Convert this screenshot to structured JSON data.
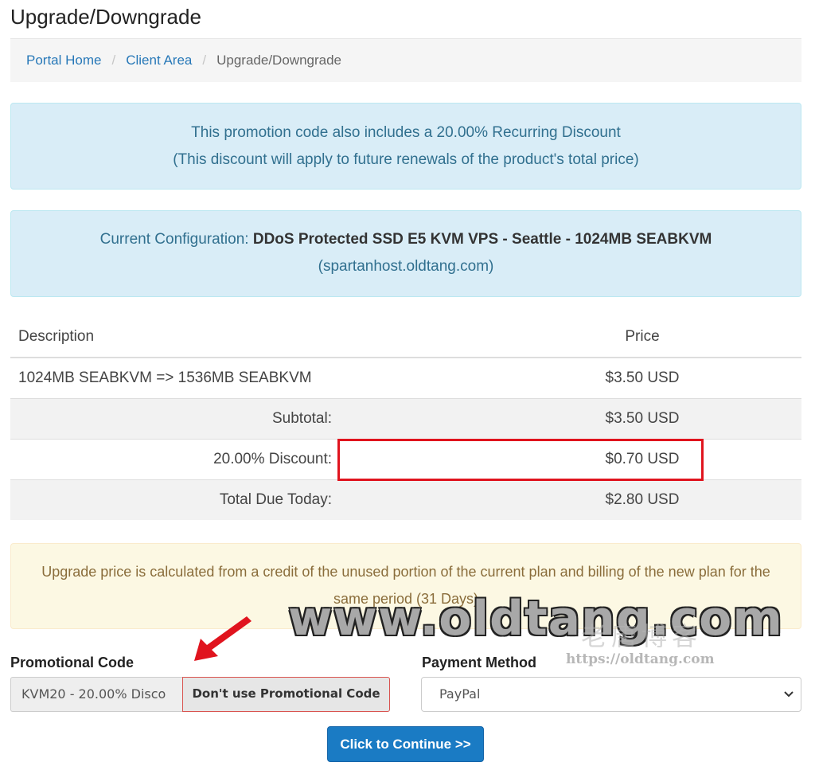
{
  "page": {
    "title": "Upgrade/Downgrade"
  },
  "breadcrumb": {
    "home": "Portal Home",
    "client_area": "Client Area",
    "current": "Upgrade/Downgrade",
    "separator": "/"
  },
  "promo_alert": {
    "line1": "This promotion code also includes a 20.00% Recurring Discount",
    "line2": "(This discount will apply to future renewals of the product's total price)"
  },
  "config_alert": {
    "label": "Current Configuration:",
    "product": "DDoS Protected SSD E5 KVM VPS - Seattle - 1024MB SEABKVM",
    "domain": "(spartanhost.oldtang.com)"
  },
  "table": {
    "headers": {
      "description": "Description",
      "price": "Price"
    },
    "item": {
      "description": "1024MB SEABKVM => 1536MB SEABKVM",
      "price": "$3.50 USD"
    },
    "subtotal": {
      "label": "Subtotal:",
      "value": "$3.50 USD"
    },
    "discount": {
      "label": "20.00% Discount:",
      "value": "$0.70 USD"
    },
    "total": {
      "label": "Total Due Today:",
      "value": "$2.80 USD"
    }
  },
  "warning": {
    "text": "Upgrade price is calculated from a credit of the unused portion of the current plan and billing of the new plan for the same period (31 Days)"
  },
  "promo": {
    "label": "Promotional Code",
    "value": "KVM20 - 20.00% Disco",
    "remove_label": "Don't use Promotional Code"
  },
  "payment": {
    "label": "Payment Method",
    "selected": "PayPal"
  },
  "continue_label": "Click to Continue >>",
  "watermark": {
    "main": "www.oldtang.com",
    "cn": "老唐博客",
    "url": "https://oldtang.com"
  },
  "colors": {
    "link": "#2778b8",
    "highlight": "#e0141e",
    "button": "#1a7bc4"
  }
}
